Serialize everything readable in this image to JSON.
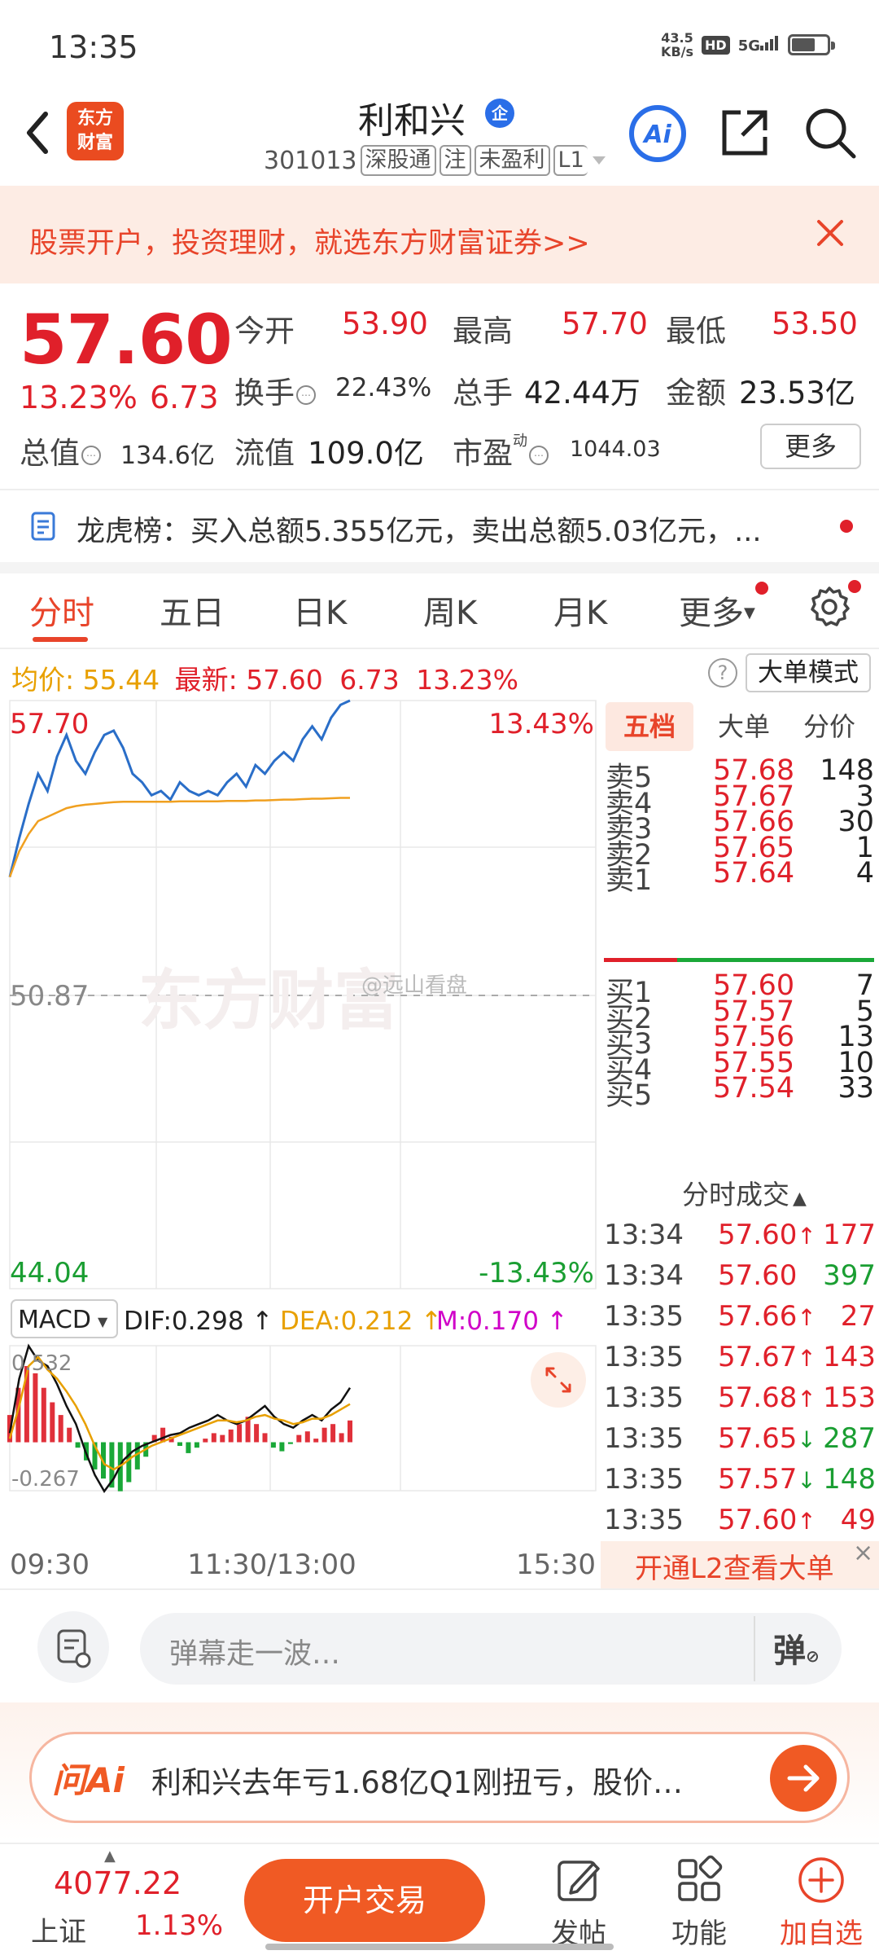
{
  "status_bar": {
    "time": "13:35",
    "net_speed_value": "43.5",
    "net_speed_unit": "KB/s",
    "hd": "HD",
    "signal": "5G"
  },
  "nav": {
    "logo_line1": "东方",
    "logo_line2": "财富",
    "stock_name": "利和兴",
    "badge": "企",
    "code": "301013",
    "tags": [
      "深股通",
      "注",
      "未盈利",
      "L1"
    ]
  },
  "banner": {
    "text": "股票开户，投资理财，就选东方财富证券>>"
  },
  "quote": {
    "price": "57.60",
    "change_pct": "13.23%",
    "change": "6.73",
    "open_label": "今开",
    "open": "53.90",
    "high_label": "最高",
    "high": "57.70",
    "low_label": "最低",
    "low": "53.50",
    "turnover_label": "换手",
    "turnover": "22.43%",
    "volume_label": "总手",
    "volume": "42.44万",
    "amount_label": "金额",
    "amount": "23.53亿",
    "mktcap_label": "总值",
    "mktcap": "134.6亿",
    "float_label": "流值",
    "float_cap": "109.0亿",
    "pe_label": "市盈",
    "pe_sup": "动",
    "pe": "1044.03",
    "more": "更多"
  },
  "dragon": {
    "text": "龙虎榜：买入总额5.355亿元，卖出总额5.03亿元，..."
  },
  "tabs": [
    "分时",
    "五日",
    "日K",
    "周K",
    "月K",
    "更多"
  ],
  "info_line": {
    "avg_label": "均价:",
    "avg": "55.44",
    "last_label": "最新:",
    "last": "57.60",
    "chg": "6.73",
    "pct": "13.23%",
    "help": "?",
    "big_order_mode": "大单模式"
  },
  "chart_labels": {
    "top_price": "57.70",
    "top_pct": "13.43%",
    "mid_price": "50.87",
    "bottom_price": "44.04",
    "bottom_pct": "-13.43%",
    "watermark": "东方财富",
    "weibo_mark": "@远山看盘",
    "macd_selector": "MACD",
    "dif": "DIF:0.298",
    "dea": "DEA:0.212",
    "m": "M:0.170",
    "macd_top": "0.532",
    "macd_bottom": "-0.267",
    "time_start": "09:30",
    "time_mid": "11:30/13:00",
    "time_end": "15:30"
  },
  "chart_data": {
    "type": "line",
    "title": "",
    "ylim": [
      44.04,
      57.7
    ],
    "baseline": 50.87,
    "x_session": [
      "09:30",
      "11:30/13:00",
      "15:30"
    ],
    "series": [
      {
        "name": "",
        "color": "#2a6ec8",
        "values": [
          53.6,
          54.5,
          55.3,
          56.0,
          55.6,
          56.4,
          56.9,
          56.3,
          56.0,
          56.5,
          56.9,
          57.0,
          56.6,
          56.0,
          55.8,
          55.5,
          55.6,
          55.4,
          55.8,
          55.6,
          55.5,
          55.6,
          55.5,
          55.8,
          56.0,
          55.7,
          56.2,
          56.0,
          56.3,
          56.5,
          56.3,
          56.8,
          57.1,
          56.8,
          57.3,
          57.6,
          57.7
        ]
      },
      {
        "name": "",
        "color": "#f0a020",
        "values": [
          53.6,
          54.2,
          54.6,
          54.9,
          55.0,
          55.1,
          55.2,
          55.25,
          55.28,
          55.3,
          55.32,
          55.34,
          55.35,
          55.35,
          55.35,
          55.35,
          55.35,
          55.35,
          55.36,
          55.36,
          55.36,
          55.36,
          55.36,
          55.37,
          55.37,
          55.37,
          55.38,
          55.38,
          55.39,
          55.4,
          55.4,
          55.41,
          55.42,
          55.42,
          55.43,
          55.44,
          55.44
        ]
      }
    ],
    "macd": {
      "ylim": [
        -0.267,
        0.532
      ],
      "histogram": [
        0.15,
        0.3,
        0.42,
        0.38,
        0.3,
        0.22,
        0.15,
        0.08,
        -0.03,
        -0.1,
        -0.15,
        -0.2,
        -0.25,
        -0.27,
        -0.22,
        -0.15,
        -0.08,
        0.04,
        0.08,
        0.03,
        -0.02,
        -0.06,
        -0.03,
        0.02,
        0.05,
        0.04,
        0.07,
        0.1,
        0.14,
        0.1,
        0.05,
        -0.03,
        -0.05,
        -0.01,
        0.04,
        0.06,
        0.02,
        0.08,
        0.1,
        0.05,
        0.12
      ],
      "dif": [
        0.05,
        0.35,
        0.53,
        0.45,
        0.42,
        0.32,
        0.2,
        0.1,
        -0.05,
        -0.18,
        -0.27,
        -0.2,
        -0.1,
        -0.05,
        -0.02,
        0.0,
        0.02,
        0.04,
        0.05,
        0.08,
        0.1,
        0.12,
        0.15,
        0.12,
        0.1,
        0.12,
        0.16,
        0.2,
        0.14,
        0.1,
        0.08,
        0.12,
        0.15,
        0.12,
        0.18,
        0.22,
        0.3
      ],
      "dea": [
        0.02,
        0.2,
        0.42,
        0.47,
        0.4,
        0.35,
        0.28,
        0.2,
        0.1,
        -0.02,
        -0.12,
        -0.15,
        -0.12,
        -0.08,
        -0.05,
        -0.02,
        0.0,
        0.02,
        0.04,
        0.06,
        0.08,
        0.1,
        0.12,
        0.12,
        0.11,
        0.12,
        0.14,
        0.15,
        0.13,
        0.12,
        0.1,
        0.11,
        0.13,
        0.13,
        0.15,
        0.18,
        0.21
      ]
    }
  },
  "order_book": {
    "tabs": [
      "五档",
      "大单",
      "分价"
    ],
    "asks": [
      {
        "label": "卖5",
        "price": "57.68",
        "vol": "148"
      },
      {
        "label": "卖4",
        "price": "57.67",
        "vol": "3"
      },
      {
        "label": "卖3",
        "price": "57.66",
        "vol": "30"
      },
      {
        "label": "卖2",
        "price": "57.65",
        "vol": "1"
      },
      {
        "label": "卖1",
        "price": "57.64",
        "vol": "4"
      }
    ],
    "bids": [
      {
        "label": "买1",
        "price": "57.60",
        "vol": "7"
      },
      {
        "label": "买2",
        "price": "57.57",
        "vol": "5"
      },
      {
        "label": "买3",
        "price": "57.56",
        "vol": "13"
      },
      {
        "label": "买4",
        "price": "57.55",
        "vol": "10"
      },
      {
        "label": "买5",
        "price": "57.54",
        "vol": "33"
      }
    ],
    "ticks_title": "分时成交",
    "ticks": [
      {
        "time": "13:34",
        "price": "57.60",
        "dir": "↑",
        "vol": "177",
        "vol_color": "red"
      },
      {
        "time": "13:34",
        "price": "57.60",
        "dir": "",
        "vol": "397",
        "vol_color": "green"
      },
      {
        "time": "13:35",
        "price": "57.66",
        "dir": "↑",
        "vol": "27",
        "vol_color": "red"
      },
      {
        "time": "13:35",
        "price": "57.67",
        "dir": "↑",
        "vol": "143",
        "vol_color": "red"
      },
      {
        "time": "13:35",
        "price": "57.68",
        "dir": "↑",
        "vol": "153",
        "vol_color": "red"
      },
      {
        "time": "13:35",
        "price": "57.65",
        "dir": "↓",
        "vol": "287",
        "vol_color": "green"
      },
      {
        "time": "13:35",
        "price": "57.57",
        "dir": "↓",
        "vol": "148",
        "vol_color": "green"
      },
      {
        "time": "13:35",
        "price": "57.60",
        "dir": "↑",
        "vol": "49",
        "vol_color": "red"
      }
    ],
    "l2_text": "开通L2查看大单"
  },
  "comment": {
    "placeholder": "弹幕走一波…",
    "dan": "弹"
  },
  "ai": {
    "logo": "问Ai",
    "text": "利和兴去年亏1.68亿Q1刚扭亏，股价…"
  },
  "bottom_nav": {
    "index_value": "4077.22",
    "index_name": "上证",
    "index_pct": "1.13%",
    "trade": "开户交易",
    "post": "发帖",
    "func": "功能",
    "fav": "加自选"
  }
}
